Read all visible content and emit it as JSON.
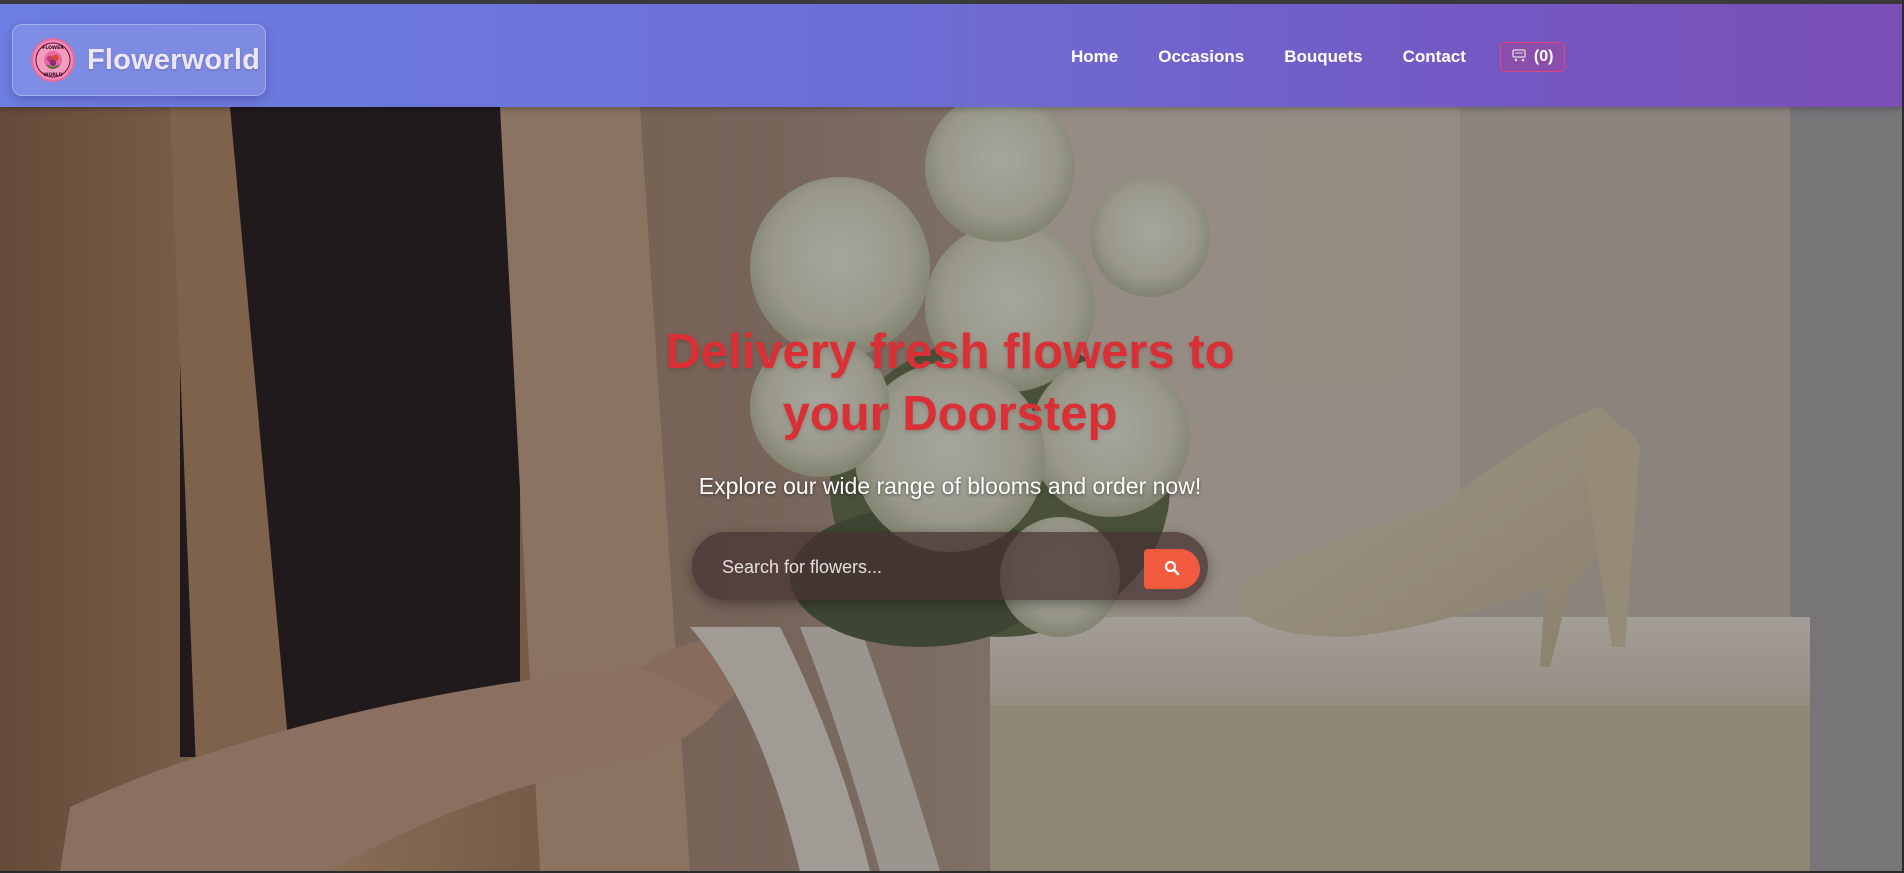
{
  "brand": {
    "name": "Flowerworld",
    "logo_text_top": "FLOWER",
    "logo_text_bottom": "WORLD"
  },
  "nav": {
    "items": [
      {
        "label": "Home"
      },
      {
        "label": "Occasions"
      },
      {
        "label": "Bouquets"
      },
      {
        "label": "Contact"
      }
    ],
    "cart": {
      "icon": "cart-icon",
      "label": "(0)"
    }
  },
  "hero": {
    "title": "Delivery fresh flowers to your Doorstep",
    "subtitle": "Explore our wide range of blooms and order now!",
    "search": {
      "placeholder": "Search for flowers...",
      "value": "",
      "button_icon": "search-icon"
    }
  },
  "colors": {
    "header_gradient_start": "#6c7ee1",
    "header_gradient_end": "#7a4fb5",
    "title_red": "#d92f35",
    "search_button": "#f25a40",
    "cart_border": "#e0457c"
  }
}
